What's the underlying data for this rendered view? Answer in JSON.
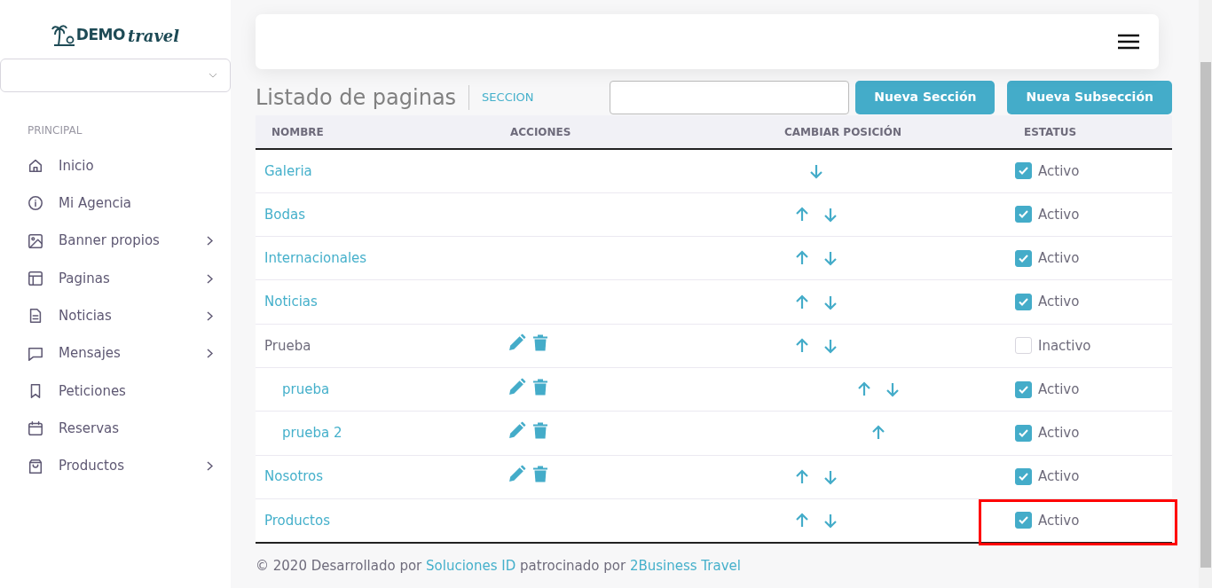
{
  "brand": {
    "word_1": "DEMO",
    "word_2": "travel"
  },
  "sidebar": {
    "section_label": "PRINCIPAL",
    "items": [
      {
        "label": "Inicio",
        "has_submenu": false
      },
      {
        "label": "Mi Agencia",
        "has_submenu": false
      },
      {
        "label": "Banner propios",
        "has_submenu": true
      },
      {
        "label": "Paginas",
        "has_submenu": true
      },
      {
        "label": "Noticias",
        "has_submenu": true
      },
      {
        "label": "Mensajes",
        "has_submenu": true
      },
      {
        "label": "Peticiones",
        "has_submenu": false
      },
      {
        "label": "Reservas",
        "has_submenu": false
      },
      {
        "label": "Productos",
        "has_submenu": true
      }
    ]
  },
  "page": {
    "title": "Listado de paginas",
    "subtitle": "SECCION"
  },
  "toolbar": {
    "buttons": [
      "Nueva Sección",
      "Nueva Subsección"
    ]
  },
  "table": {
    "columns": [
      "NOMBRE",
      "ACCIONES",
      "CAMBIAR POSICIÓN",
      "ESTATUS"
    ],
    "rows": [
      {
        "name": "Galeria",
        "kind": "section",
        "link": true,
        "editable": false,
        "can_up": false,
        "can_down": true,
        "checked": true,
        "status": "Activo",
        "highlighted": false
      },
      {
        "name": "Bodas",
        "kind": "section",
        "link": true,
        "editable": false,
        "can_up": true,
        "can_down": true,
        "checked": true,
        "status": "Activo",
        "highlighted": false
      },
      {
        "name": "Internacionales",
        "kind": "section",
        "link": true,
        "editable": false,
        "can_up": true,
        "can_down": true,
        "checked": true,
        "status": "Activo",
        "highlighted": false
      },
      {
        "name": "Noticias",
        "kind": "section",
        "link": true,
        "editable": false,
        "can_up": true,
        "can_down": true,
        "checked": true,
        "status": "Activo",
        "highlighted": false
      },
      {
        "name": "Prueba",
        "kind": "section",
        "link": false,
        "editable": true,
        "can_up": true,
        "can_down": true,
        "checked": false,
        "status": "Inactivo",
        "highlighted": false
      },
      {
        "name": "prueba",
        "kind": "subsection",
        "link": true,
        "editable": true,
        "can_up": true,
        "can_down": true,
        "checked": true,
        "status": "Activo",
        "highlighted": false
      },
      {
        "name": "prueba 2",
        "kind": "subsection",
        "link": true,
        "editable": true,
        "can_up": true,
        "can_down": false,
        "checked": true,
        "status": "Activo",
        "highlighted": false
      },
      {
        "name": "Nosotros",
        "kind": "section",
        "link": true,
        "editable": true,
        "can_up": true,
        "can_down": true,
        "checked": true,
        "status": "Activo",
        "highlighted": false
      },
      {
        "name": "Productos",
        "kind": "section",
        "link": true,
        "editable": false,
        "can_up": true,
        "can_down": true,
        "checked": true,
        "status": "Activo",
        "highlighted": true
      }
    ]
  },
  "footer": {
    "text_1": "© 2020 Desarrollado por",
    "link_1": "Soluciones ID",
    "text_2": "patrocinado por",
    "link_2": "2Business Travel"
  }
}
